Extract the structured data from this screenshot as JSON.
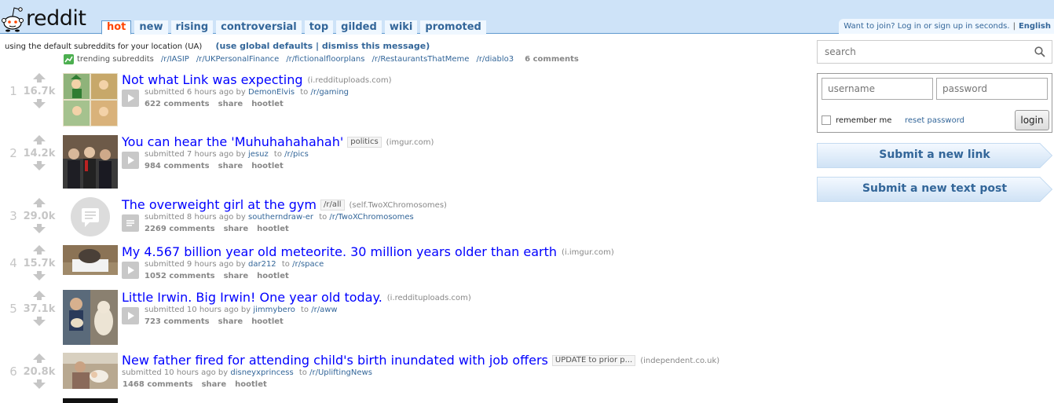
{
  "header": {
    "logo_text": "reddit",
    "tabs": [
      {
        "label": "hot",
        "selected": true
      },
      {
        "label": "new"
      },
      {
        "label": "rising"
      },
      {
        "label": "controversial"
      },
      {
        "label": "top"
      },
      {
        "label": "gilded"
      },
      {
        "label": "wiki"
      },
      {
        "label": "promoted"
      }
    ],
    "join_text": "Want to join? Log in or sign up in seconds.",
    "separator": "|",
    "language": "English"
  },
  "infobar": {
    "message": "using the default subreddits for your location (UA)",
    "actions": "(use global defaults | dismiss this message)"
  },
  "trending": {
    "label": "trending subreddits",
    "subreddits": [
      "/r/IASIP",
      "/r/UKPersonalFinance",
      "/r/fictionalfloorplans",
      "/r/RestaurantsThatMeme",
      "/r/diablo3"
    ],
    "comments": "6 comments"
  },
  "posts": [
    {
      "rank": "1",
      "score": "16.7k",
      "title": "Not what Link was expecting",
      "flair": "",
      "domain": "(i.reddituploads.com)",
      "submitted": "submitted 6 hours ago by",
      "author": "DemonElvis",
      "to": "to",
      "subreddit": "/r/gaming",
      "comments": "622 comments",
      "share": "share",
      "hootlet": "hootlet",
      "thumb": "comic",
      "expando": "video"
    },
    {
      "rank": "2",
      "score": "14.2k",
      "title": "You can hear the 'Muhuhahahahah'",
      "flair": "politics",
      "domain": "(imgur.com)",
      "submitted": "submitted 7 hours ago by",
      "author": "jesuz",
      "to": "to",
      "subreddit": "/r/pics",
      "comments": "984 comments",
      "share": "share",
      "hootlet": "hootlet",
      "thumb": "crowd",
      "expando": "video"
    },
    {
      "rank": "3",
      "score": "29.0k",
      "title": "The overweight girl at the gym",
      "flair": "/r/all",
      "domain": "(self.TwoXChromosomes)",
      "submitted": "submitted 8 hours ago by",
      "author": "southerndraw-er",
      "to": "to",
      "subreddit": "/r/TwoXChromosomes",
      "comments": "2269 comments",
      "share": "share",
      "hootlet": "hootlet",
      "thumb": "self",
      "expando": "text"
    },
    {
      "rank": "4",
      "score": "15.7k",
      "title": "My 4.567 billion year old meteorite. 30 million years older than earth",
      "flair": "",
      "domain": "(i.imgur.com)",
      "submitted": "submitted 9 hours ago by",
      "author": "dar212",
      "to": "to",
      "subreddit": "/r/space",
      "comments": "1052 comments",
      "share": "share",
      "hootlet": "hootlet",
      "thumb": "meteorite",
      "expando": "video"
    },
    {
      "rank": "5",
      "score": "37.1k",
      "title": "Little Irwin. Big Irwin! One year old today.",
      "flair": "",
      "domain": "(i.reddituploads.com)",
      "submitted": "submitted 10 hours ago by",
      "author": "jimmybero",
      "to": "to",
      "subreddit": "/r/aww",
      "comments": "723 comments",
      "share": "share",
      "hootlet": "hootlet",
      "thumb": "dogs",
      "expando": "video"
    },
    {
      "rank": "6",
      "score": "20.8k",
      "title": "New father fired for attending child's birth inundated with job offers",
      "flair": "UPDATE to prior p...",
      "domain": "(independent.co.uk)",
      "submitted": "submitted 10 hours ago by",
      "author": "disneyxprincess",
      "to": "to",
      "subreddit": "/r/UpliftingNews",
      "comments": "1468 comments",
      "share": "share",
      "hootlet": "hootlet",
      "thumb": "baby",
      "expando": "none"
    }
  ],
  "side": {
    "search_placeholder": "search",
    "username_placeholder": "username",
    "password_placeholder": "password",
    "remember_label": "remember me",
    "reset_label": "reset password",
    "login_label": "login",
    "submit_link": "Submit a new link",
    "submit_text": "Submit a new text post"
  },
  "colors": {
    "header_bg": "#cee3f8",
    "link_blue": "#0000ff",
    "tab_selected": "#ff4500",
    "subtle": "#369"
  }
}
